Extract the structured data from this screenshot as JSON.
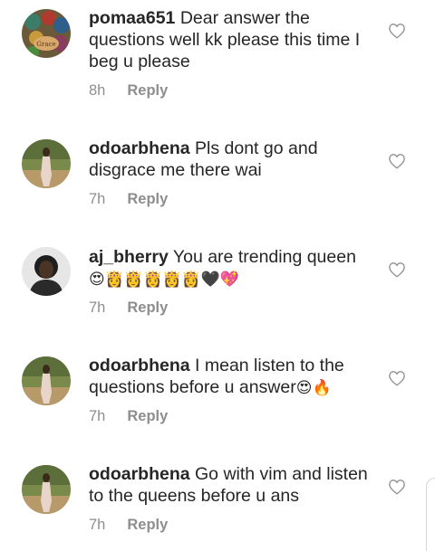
{
  "comments": [
    {
      "username": "pomaa651",
      "text": "Dear answer the questions well kk please this time I beg u please",
      "time": "8h",
      "reply_label": "Reply",
      "avatar_caption": "Grace",
      "emoji": ""
    },
    {
      "username": "odoarbhena",
      "text": "Pls dont go and disgrace me there wai",
      "time": "7h",
      "reply_label": "Reply",
      "emoji": ""
    },
    {
      "username": "aj_bherry",
      "text": "You are trending queen",
      "time": "7h",
      "reply_label": "Reply",
      "emoji": "😍👸👸👸👸👸🖤💖"
    },
    {
      "username": "odoarbhena",
      "text": "I mean listen to the questions before u answer",
      "time": "7h",
      "reply_label": "Reply",
      "emoji": "😍🔥"
    },
    {
      "username": "odoarbhena",
      "text": "Go with vim and listen to the queens before u ans",
      "time": "7h",
      "reply_label": "Reply",
      "emoji": ""
    }
  ],
  "icons": {
    "like": "heart-outline-icon"
  },
  "colors": {
    "text": "#262626",
    "meta": "#8e8e8e",
    "icon": "#8e8e8e"
  }
}
